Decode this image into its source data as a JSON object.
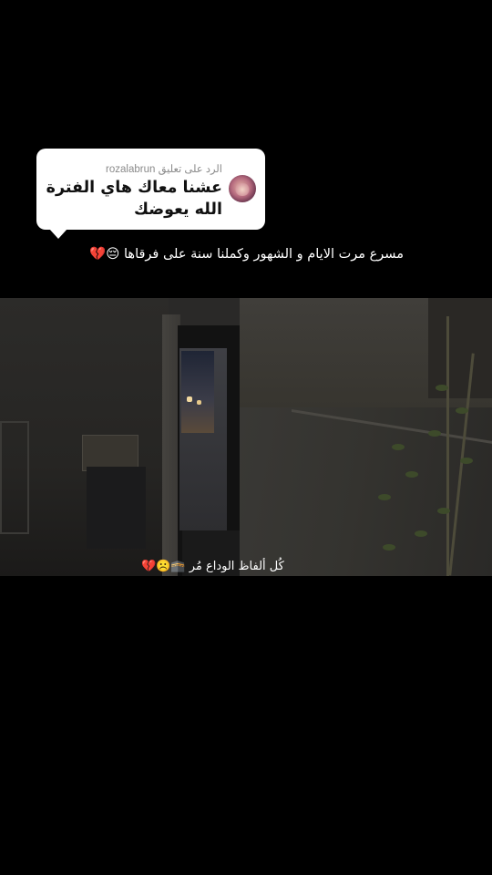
{
  "reply": {
    "header": "الرد على تعليق rozalabrun",
    "comment": "عشنا معاك هاي الفترة الله يعوضك"
  },
  "caption": "مسرع مرت الايام و الشهور وكملنا سنة على فرقاها 😔💔",
  "video": {
    "overlay_text": "كُل ألفاظ الوداع مُر 🕋☹️💔"
  },
  "colors": {
    "background": "#000000",
    "bubble": "#ffffff"
  }
}
